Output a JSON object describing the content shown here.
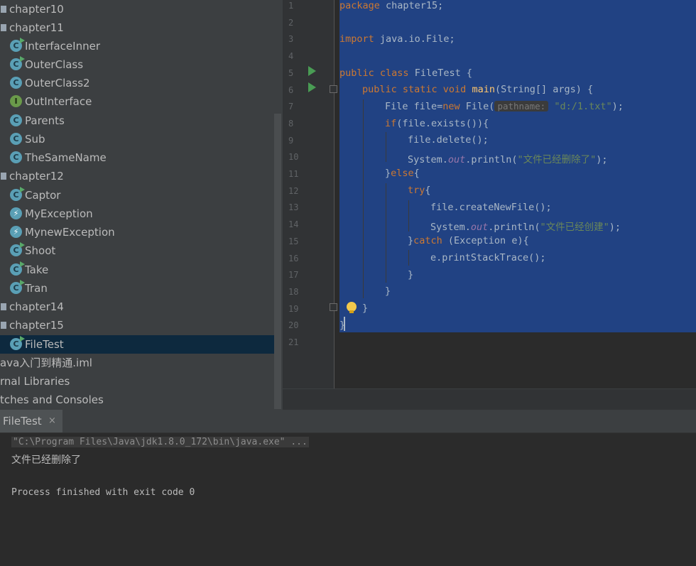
{
  "tree": {
    "items": [
      {
        "label": "chapter10",
        "kind": "folder"
      },
      {
        "label": "chapter11",
        "kind": "folder"
      },
      {
        "label": "InterfaceInner",
        "kind": "class",
        "runnable": true
      },
      {
        "label": "OuterClass",
        "kind": "class",
        "runnable": true
      },
      {
        "label": "OuterClass2",
        "kind": "class",
        "runnable": false
      },
      {
        "label": "OutInterface",
        "kind": "interface",
        "runnable": false
      },
      {
        "label": "Parents",
        "kind": "class",
        "runnable": false
      },
      {
        "label": "Sub",
        "kind": "class",
        "runnable": false
      },
      {
        "label": "TheSameName",
        "kind": "class",
        "runnable": false
      },
      {
        "label": "chapter12",
        "kind": "folder"
      },
      {
        "label": "Captor",
        "kind": "class",
        "runnable": true
      },
      {
        "label": "MyException",
        "kind": "exception",
        "runnable": false
      },
      {
        "label": "MynewException",
        "kind": "exception",
        "runnable": false
      },
      {
        "label": "Shoot",
        "kind": "class",
        "runnable": true
      },
      {
        "label": "Take",
        "kind": "class",
        "runnable": true
      },
      {
        "label": "Tran",
        "kind": "class",
        "runnable": true
      },
      {
        "label": "chapter14",
        "kind": "folder"
      },
      {
        "label": "chapter15",
        "kind": "folder"
      },
      {
        "label": "FileTest",
        "kind": "class",
        "runnable": true,
        "selected": true
      },
      {
        "label": "ava入门到精通.iml",
        "kind": "file"
      },
      {
        "label": "rnal Libraries",
        "kind": "file"
      },
      {
        "label": "tches and Consoles",
        "kind": "file"
      }
    ]
  },
  "editor": {
    "line_numbers": [
      "1",
      "2",
      "3",
      "4",
      "5",
      "6",
      "7",
      "8",
      "9",
      "10",
      "11",
      "12",
      "13",
      "14",
      "15",
      "16",
      "17",
      "18",
      "19",
      "20",
      "21"
    ],
    "code": {
      "l1_kw": "package",
      "l1_rest": " chapter15;",
      "l3_kw": "import",
      "l3_rest": " java.io.File;",
      "l5_kw1": "public",
      "l5_kw2": "class",
      "l5_rest": " FileTest {",
      "l6_kw": "public static void",
      "l6_fn": "main",
      "l6_rest": "(String[] args) {",
      "l7_a": "File file=",
      "l7_kw": "new",
      "l7_b": " File(",
      "l7_hint": "pathname:",
      "l7_str": "\"d:/1.txt\"",
      "l7_c": ");",
      "l8_kw": "if",
      "l8_rest": "(file.exists()){",
      "l9": "file.delete();",
      "l10_a": "System.",
      "l10_fld": "out",
      "l10_b": ".println(",
      "l10_str": "\"文件已经删除了\"",
      "l10_c": ");",
      "l11_a": "}",
      "l11_kw": "else",
      "l11_b": "{",
      "l12_kw": "try",
      "l12_b": "{",
      "l13": "file.createNewFile();",
      "l14_a": "System.",
      "l14_fld": "out",
      "l14_b": ".println(",
      "l14_str": "\"文件已经创建\"",
      "l14_c": ");",
      "l15_a": "}",
      "l15_kw": "catch",
      "l15_b": " (Exception e){",
      "l16": "e.printStackTrace();",
      "l17": "}",
      "l18": "}",
      "l19": "}",
      "l20": "}"
    }
  },
  "run": {
    "tab_label": "FileTest",
    "tab_close": "×",
    "lines": {
      "cmd": "\"C:\\Program Files\\Java\\jdk1.8.0_172\\bin\\java.exe\" ...",
      "out": "文件已经删除了",
      "exit": "Process finished with exit code 0"
    }
  },
  "colors": {
    "tree_bg": "#3c3f41",
    "editor_bg": "#2b2b2b",
    "selection": "#214283",
    "keyword": "#cc7832",
    "string": "#6a8759",
    "field": "#9876aa",
    "method": "#ffc66d",
    "run_arrow": "#499c54"
  }
}
